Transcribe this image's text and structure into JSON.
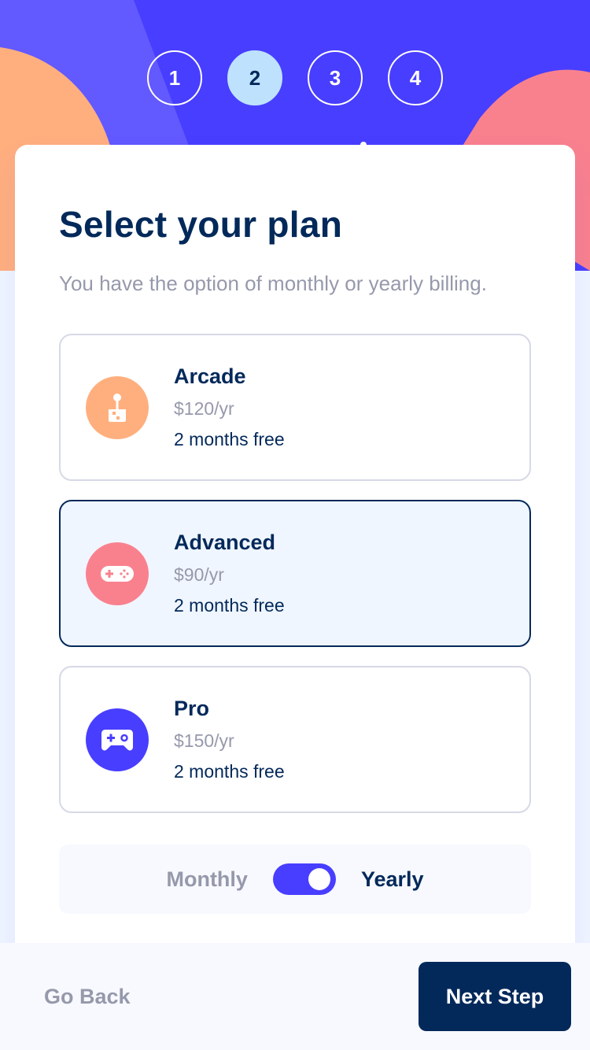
{
  "steps": [
    "1",
    "2",
    "3",
    "4"
  ],
  "active_step": 2,
  "form": {
    "title": "Select your plan",
    "subtitle": "You have the option of monthly or yearly billing."
  },
  "plans": [
    {
      "name": "Arcade",
      "price": "$120/yr",
      "promo": "2 months free",
      "icon": "arcade-joystick-icon",
      "color": "#ffaf7e",
      "selected": false
    },
    {
      "name": "Advanced",
      "price": "$90/yr",
      "promo": "2 months free",
      "icon": "advanced-gamepad-icon",
      "color": "#f9818e",
      "selected": true
    },
    {
      "name": "Pro",
      "price": "$150/yr",
      "promo": "2 months free",
      "icon": "pro-controller-icon",
      "color": "#483eff",
      "selected": false
    }
  ],
  "billing": {
    "monthly_label": "Monthly",
    "yearly_label": "Yearly",
    "selected": "Yearly"
  },
  "footer": {
    "back_label": "Go Back",
    "next_label": "Next Step"
  },
  "colors": {
    "primary": "#483eff",
    "marine": "#02295a",
    "gray": "#9699ab",
    "light_blue": "#bee2fd",
    "orange": "#ffaf7e",
    "pink": "#f9818e"
  }
}
